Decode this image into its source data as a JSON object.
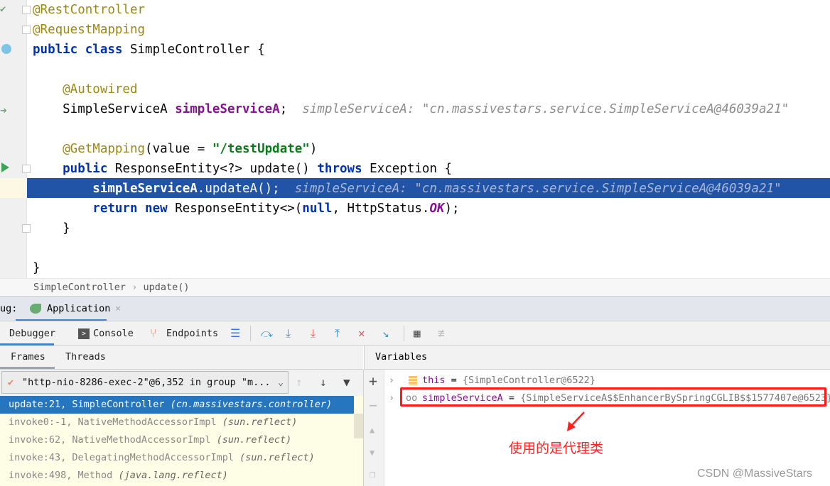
{
  "editor": {
    "lines": [
      [
        {
          "t": "@RestController",
          "c": "ann"
        }
      ],
      [
        {
          "t": "@RequestMapping",
          "c": "ann"
        }
      ],
      [
        {
          "t": "public class ",
          "c": "kw"
        },
        {
          "t": "SimpleController {",
          "c": ""
        }
      ],
      [],
      [
        {
          "t": "    @Autowired",
          "c": "ann"
        }
      ],
      [
        {
          "t": "    SimpleServiceA ",
          "c": ""
        },
        {
          "t": "simpleServiceA",
          "c": "fld"
        },
        {
          "t": ";  ",
          "c": ""
        },
        {
          "t": "simpleServiceA: \"cn.massivestars.service.SimpleServiceA@46039a21\"",
          "c": "hint"
        }
      ],
      [],
      [
        {
          "t": "    @GetMapping",
          "c": "ann"
        },
        {
          "t": "(value = ",
          "c": ""
        },
        {
          "t": "\"/testUpdate\"",
          "c": "str"
        },
        {
          "t": ")",
          "c": ""
        }
      ],
      [
        {
          "t": "    public ",
          "c": "kw"
        },
        {
          "t": "ResponseEntity<?> update() ",
          "c": ""
        },
        {
          "t": "throws ",
          "c": "kw"
        },
        {
          "t": "Exception {",
          "c": ""
        }
      ],
      [
        {
          "t": "        simpleServiceA",
          "c": "fld"
        },
        {
          "t": ".updateA();  ",
          "c": ""
        },
        {
          "t": "simpleServiceA: \"cn.massivestars.service.SimpleServiceA@46039a21\"",
          "c": "hint"
        }
      ],
      [
        {
          "t": "        return new ",
          "c": "kw"
        },
        {
          "t": "ResponseEntity<>(",
          "c": ""
        },
        {
          "t": "null",
          "c": "kw"
        },
        {
          "t": ", HttpStatus.",
          "c": ""
        },
        {
          "t": "OK",
          "c": "const"
        },
        {
          "t": ");",
          "c": ""
        }
      ],
      [
        {
          "t": "    }",
          "c": ""
        }
      ],
      [],
      [
        {
          "t": "}",
          "c": ""
        }
      ]
    ],
    "selected_line": 9
  },
  "breadcrumb": {
    "class": "SimpleController",
    "sep": "›",
    "method": "update()"
  },
  "debug": {
    "label": "ug:",
    "tab": "Application"
  },
  "toolbar": {
    "debugger": "Debugger",
    "console": "Console",
    "endpoints": "Endpoints"
  },
  "frames": {
    "tab_frames": "Frames",
    "tab_threads": "Threads",
    "thread": "\"http-nio-8286-exec-2\"@6,352 in group \"m...",
    "items": [
      {
        "loc": "update:21, SimpleController ",
        "pkg": "(cn.massivestars.controller)"
      },
      {
        "loc": "invoke0:-1, NativeMethodAccessorImpl ",
        "pkg": "(sun.reflect)"
      },
      {
        "loc": "invoke:62, NativeMethodAccessorImpl ",
        "pkg": "(sun.reflect)"
      },
      {
        "loc": "invoke:43, DelegatingMethodAccessorImpl ",
        "pkg": "(sun.reflect)"
      },
      {
        "loc": "invoke:498, Method ",
        "pkg": "(java.lang.reflect)"
      }
    ]
  },
  "variables": {
    "title": "Variables",
    "items": [
      {
        "name": "this",
        "eq": " = ",
        "value": "{SimpleController@6522}"
      },
      {
        "name": "simpleServiceA",
        "eq": " = ",
        "value": "{SimpleServiceA$$EnhancerBySpringCGLIB$$1577407e@6523}"
      }
    ]
  },
  "annotation": {
    "text": "使用的是代理类",
    "color": "#ff2020"
  },
  "watermark": "CSDN @MassiveStars"
}
